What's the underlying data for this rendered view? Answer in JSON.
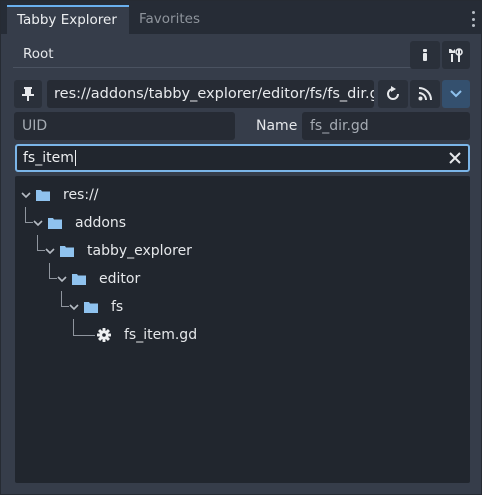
{
  "tabs": [
    {
      "label": "Tabby Explorer",
      "active": true
    },
    {
      "label": "Favorites",
      "active": false
    }
  ],
  "root_label": "Root",
  "path": {
    "value": "res://addons/tabby_explorer/editor/fs/fs_dir.gd"
  },
  "uid": {
    "placeholder": "UID"
  },
  "name": {
    "label": "Name",
    "value": "fs_dir.gd"
  },
  "search": {
    "value": "fs_item"
  },
  "tree": {
    "nodes": [
      {
        "label": "res://",
        "kind": "folder",
        "expanded": true
      },
      {
        "label": "addons",
        "kind": "folder",
        "expanded": true
      },
      {
        "label": "tabby_explorer",
        "kind": "folder",
        "expanded": true
      },
      {
        "label": "editor",
        "kind": "folder",
        "expanded": true
      },
      {
        "label": "fs",
        "kind": "folder",
        "expanded": true
      },
      {
        "label": "fs_item.gd",
        "kind": "script-file"
      }
    ]
  },
  "icons": {
    "pin": "pin-icon",
    "info": "info-icon",
    "tools": "tools-icon",
    "refresh": "refresh-icon",
    "rss": "rss-icon",
    "expand": "chevron-down-icon",
    "clear": "close-icon",
    "folder": "folder-icon",
    "gear": "gear-icon"
  },
  "colors": {
    "accent": "#6ab0ee",
    "folder": "#8fc2ee",
    "panel": "#363d4a",
    "field": "#262b34"
  }
}
